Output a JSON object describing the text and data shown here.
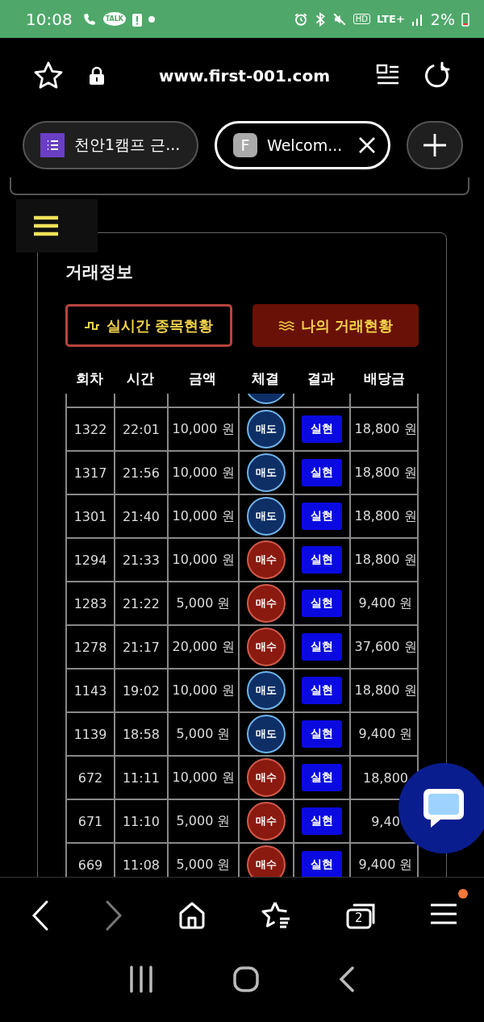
{
  "status_bar": {
    "time": "10:08",
    "talk_label": "TALK",
    "hd_label": "HD",
    "network_type": "LTE+",
    "battery": "2%"
  },
  "browser": {
    "url": "www.first-001.com",
    "tabs": [
      {
        "title": "천안1캠프 근...",
        "selected": false
      },
      {
        "favicon_letter": "F",
        "title": "Welcom...",
        "selected": true
      }
    ],
    "tab_count": "2"
  },
  "page": {
    "title": "거래정보",
    "tabs": [
      {
        "kind": "pulse",
        "label": "실시간 종목현황",
        "selected": false
      },
      {
        "kind": "waves",
        "label": "나의 거래현황",
        "selected": true
      }
    ],
    "columns": [
      "회차",
      "시간",
      "금액",
      "체결",
      "결과",
      "배당금"
    ],
    "rows": [
      {
        "round": "1322",
        "time": "22:01",
        "amount": "10,000 원",
        "kind": "sell",
        "trade": "매도",
        "result": "실현",
        "payout": "18,800 원"
      },
      {
        "round": "1317",
        "time": "21:56",
        "amount": "10,000 원",
        "kind": "sell",
        "trade": "매도",
        "result": "실현",
        "payout": "18,800 원"
      },
      {
        "round": "1301",
        "time": "21:40",
        "amount": "10,000 원",
        "kind": "sell",
        "trade": "매도",
        "result": "실현",
        "payout": "18,800 원"
      },
      {
        "round": "1294",
        "time": "21:33",
        "amount": "10,000 원",
        "kind": "buy",
        "trade": "매수",
        "result": "실현",
        "payout": "18,800 원"
      },
      {
        "round": "1283",
        "time": "21:22",
        "amount": "5,000 원",
        "kind": "buy",
        "trade": "매수",
        "result": "실현",
        "payout": "9,400 원"
      },
      {
        "round": "1278",
        "time": "21:17",
        "amount": "20,000 원",
        "kind": "buy",
        "trade": "매수",
        "result": "실현",
        "payout": "37,600 원"
      },
      {
        "round": "1143",
        "time": "19:02",
        "amount": "10,000 원",
        "kind": "sell",
        "trade": "매도",
        "result": "실현",
        "payout": "18,800 원"
      },
      {
        "round": "1139",
        "time": "18:58",
        "amount": "5,000 원",
        "kind": "sell",
        "trade": "매도",
        "result": "실현",
        "payout": "9,400 원"
      },
      {
        "round": "672",
        "time": "11:11",
        "amount": "10,000 원",
        "kind": "buy",
        "trade": "매수",
        "result": "실현",
        "payout": "18,800"
      },
      {
        "round": "671",
        "time": "11:10",
        "amount": "5,000 원",
        "kind": "buy",
        "trade": "매수",
        "result": "실현",
        "payout": "9,40"
      },
      {
        "round": "669",
        "time": "11:08",
        "amount": "5,000 원",
        "kind": "buy",
        "trade": "매수",
        "result": "실현",
        "payout": "9,400 원"
      }
    ]
  }
}
